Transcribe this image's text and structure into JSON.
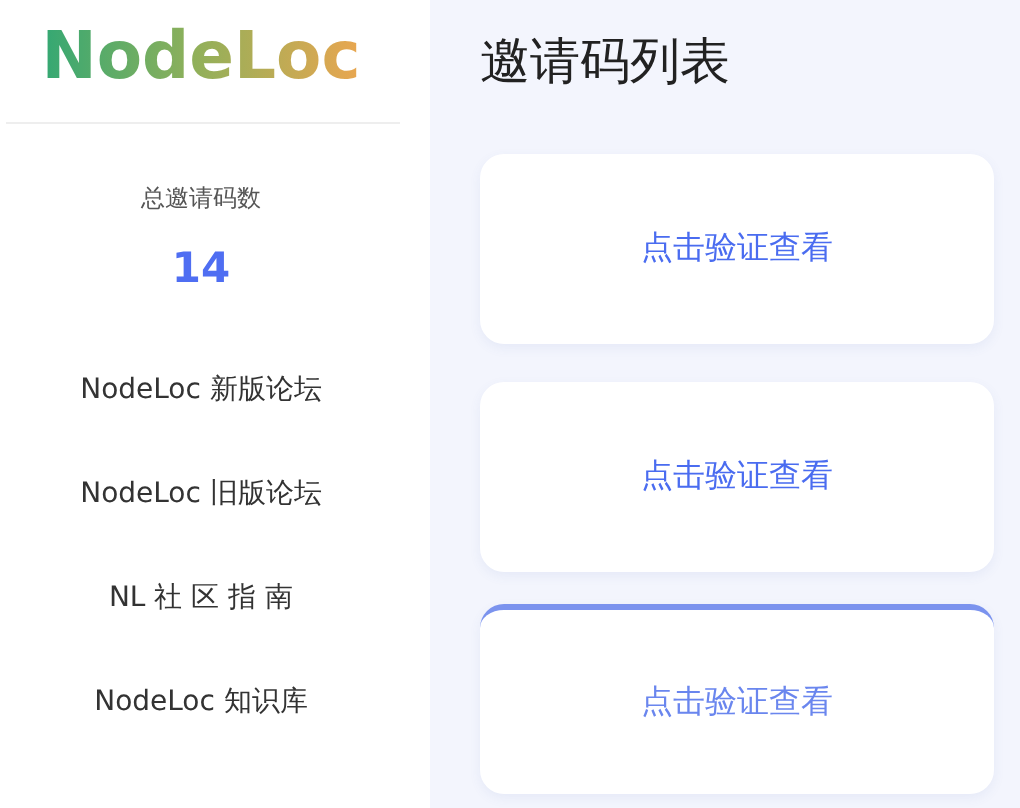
{
  "logo": "NodeLoc",
  "stats": {
    "label": "总邀请码数",
    "count": "14"
  },
  "nav": [
    {
      "label": "NodeLoc 新版论坛"
    },
    {
      "label": "NodeLoc 旧版论坛"
    },
    {
      "label": "NL 社 区 指 南"
    },
    {
      "label": "NodeLoc 知识库"
    }
  ],
  "title": "邀请码列表",
  "cards": [
    {
      "action": "点击验证查看",
      "highlighted": false
    },
    {
      "action": "点击验证查看",
      "highlighted": false
    },
    {
      "action": "点击验证查看",
      "highlighted": true
    }
  ]
}
